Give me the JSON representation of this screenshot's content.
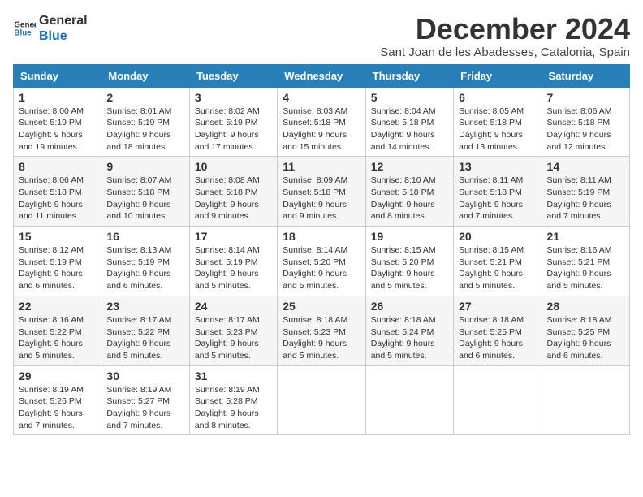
{
  "logo": {
    "line1": "General",
    "line2": "Blue"
  },
  "title": "December 2024",
  "subtitle": "Sant Joan de les Abadesses, Catalonia, Spain",
  "header": {
    "accent_color": "#2980b9"
  },
  "days_of_week": [
    "Sunday",
    "Monday",
    "Tuesday",
    "Wednesday",
    "Thursday",
    "Friday",
    "Saturday"
  ],
  "weeks": [
    [
      {
        "day": "1",
        "sunrise": "8:00 AM",
        "sunset": "5:19 PM",
        "daylight": "9 hours and 19 minutes."
      },
      {
        "day": "2",
        "sunrise": "8:01 AM",
        "sunset": "5:19 PM",
        "daylight": "9 hours and 18 minutes."
      },
      {
        "day": "3",
        "sunrise": "8:02 AM",
        "sunset": "5:19 PM",
        "daylight": "9 hours and 17 minutes."
      },
      {
        "day": "4",
        "sunrise": "8:03 AM",
        "sunset": "5:18 PM",
        "daylight": "9 hours and 15 minutes."
      },
      {
        "day": "5",
        "sunrise": "8:04 AM",
        "sunset": "5:18 PM",
        "daylight": "9 hours and 14 minutes."
      },
      {
        "day": "6",
        "sunrise": "8:05 AM",
        "sunset": "5:18 PM",
        "daylight": "9 hours and 13 minutes."
      },
      {
        "day": "7",
        "sunrise": "8:06 AM",
        "sunset": "5:18 PM",
        "daylight": "9 hours and 12 minutes."
      }
    ],
    [
      {
        "day": "8",
        "sunrise": "8:06 AM",
        "sunset": "5:18 PM",
        "daylight": "9 hours and 11 minutes."
      },
      {
        "day": "9",
        "sunrise": "8:07 AM",
        "sunset": "5:18 PM",
        "daylight": "9 hours and 10 minutes."
      },
      {
        "day": "10",
        "sunrise": "8:08 AM",
        "sunset": "5:18 PM",
        "daylight": "9 hours and 9 minutes."
      },
      {
        "day": "11",
        "sunrise": "8:09 AM",
        "sunset": "5:18 PM",
        "daylight": "9 hours and 9 minutes."
      },
      {
        "day": "12",
        "sunrise": "8:10 AM",
        "sunset": "5:18 PM",
        "daylight": "9 hours and 8 minutes."
      },
      {
        "day": "13",
        "sunrise": "8:11 AM",
        "sunset": "5:18 PM",
        "daylight": "9 hours and 7 minutes."
      },
      {
        "day": "14",
        "sunrise": "8:11 AM",
        "sunset": "5:19 PM",
        "daylight": "9 hours and 7 minutes."
      }
    ],
    [
      {
        "day": "15",
        "sunrise": "8:12 AM",
        "sunset": "5:19 PM",
        "daylight": "9 hours and 6 minutes."
      },
      {
        "day": "16",
        "sunrise": "8:13 AM",
        "sunset": "5:19 PM",
        "daylight": "9 hours and 6 minutes."
      },
      {
        "day": "17",
        "sunrise": "8:14 AM",
        "sunset": "5:19 PM",
        "daylight": "9 hours and 5 minutes."
      },
      {
        "day": "18",
        "sunrise": "8:14 AM",
        "sunset": "5:20 PM",
        "daylight": "9 hours and 5 minutes."
      },
      {
        "day": "19",
        "sunrise": "8:15 AM",
        "sunset": "5:20 PM",
        "daylight": "9 hours and 5 minutes."
      },
      {
        "day": "20",
        "sunrise": "8:15 AM",
        "sunset": "5:21 PM",
        "daylight": "9 hours and 5 minutes."
      },
      {
        "day": "21",
        "sunrise": "8:16 AM",
        "sunset": "5:21 PM",
        "daylight": "9 hours and 5 minutes."
      }
    ],
    [
      {
        "day": "22",
        "sunrise": "8:16 AM",
        "sunset": "5:22 PM",
        "daylight": "9 hours and 5 minutes."
      },
      {
        "day": "23",
        "sunrise": "8:17 AM",
        "sunset": "5:22 PM",
        "daylight": "9 hours and 5 minutes."
      },
      {
        "day": "24",
        "sunrise": "8:17 AM",
        "sunset": "5:23 PM",
        "daylight": "9 hours and 5 minutes."
      },
      {
        "day": "25",
        "sunrise": "8:18 AM",
        "sunset": "5:23 PM",
        "daylight": "9 hours and 5 minutes."
      },
      {
        "day": "26",
        "sunrise": "8:18 AM",
        "sunset": "5:24 PM",
        "daylight": "9 hours and 5 minutes."
      },
      {
        "day": "27",
        "sunrise": "8:18 AM",
        "sunset": "5:25 PM",
        "daylight": "9 hours and 6 minutes."
      },
      {
        "day": "28",
        "sunrise": "8:18 AM",
        "sunset": "5:25 PM",
        "daylight": "9 hours and 6 minutes."
      }
    ],
    [
      {
        "day": "29",
        "sunrise": "8:19 AM",
        "sunset": "5:26 PM",
        "daylight": "9 hours and 7 minutes."
      },
      {
        "day": "30",
        "sunrise": "8:19 AM",
        "sunset": "5:27 PM",
        "daylight": "9 hours and 7 minutes."
      },
      {
        "day": "31",
        "sunrise": "8:19 AM",
        "sunset": "5:28 PM",
        "daylight": "9 hours and 8 minutes."
      },
      null,
      null,
      null,
      null
    ]
  ],
  "labels": {
    "sunrise": "Sunrise:",
    "sunset": "Sunset:",
    "daylight": "Daylight:"
  }
}
